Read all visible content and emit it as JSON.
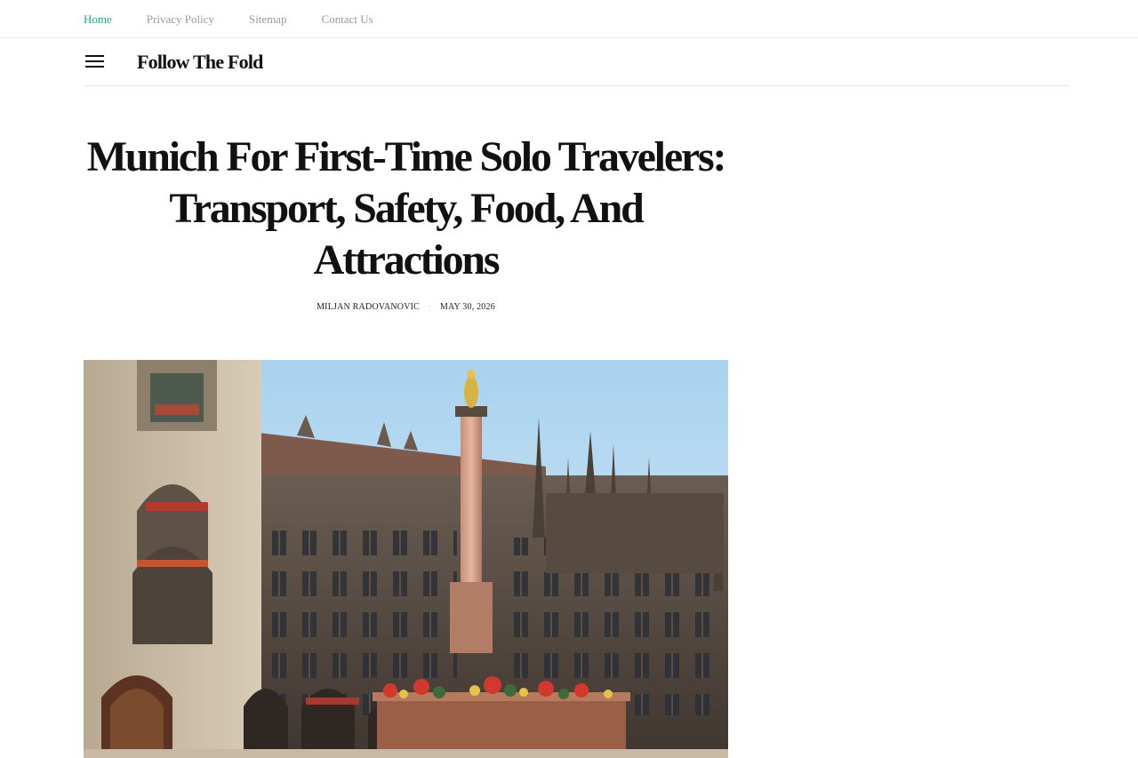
{
  "top_nav": {
    "items": [
      {
        "label": "Home",
        "active": true
      },
      {
        "label": "Privacy Policy",
        "active": false
      },
      {
        "label": "Sitemap",
        "active": false
      },
      {
        "label": "Contact Us",
        "active": false
      }
    ]
  },
  "header": {
    "site_title": "Follow The Fold",
    "menu_icon": "hamburger-menu-icon"
  },
  "article": {
    "title": "Munich For First-Time Solo Travelers: Transport, Safety, Food, And Attractions",
    "author": "MILJAN RADOVANOVIC",
    "date": "MAY 30, 2026",
    "separator": "·",
    "hero_image": "photo of Munich Marienplatz with the New Town Hall and the Mary's Column"
  },
  "colors": {
    "accent": "#23a86b",
    "nav_text": "#9a9a9a",
    "title_text": "#111111"
  }
}
